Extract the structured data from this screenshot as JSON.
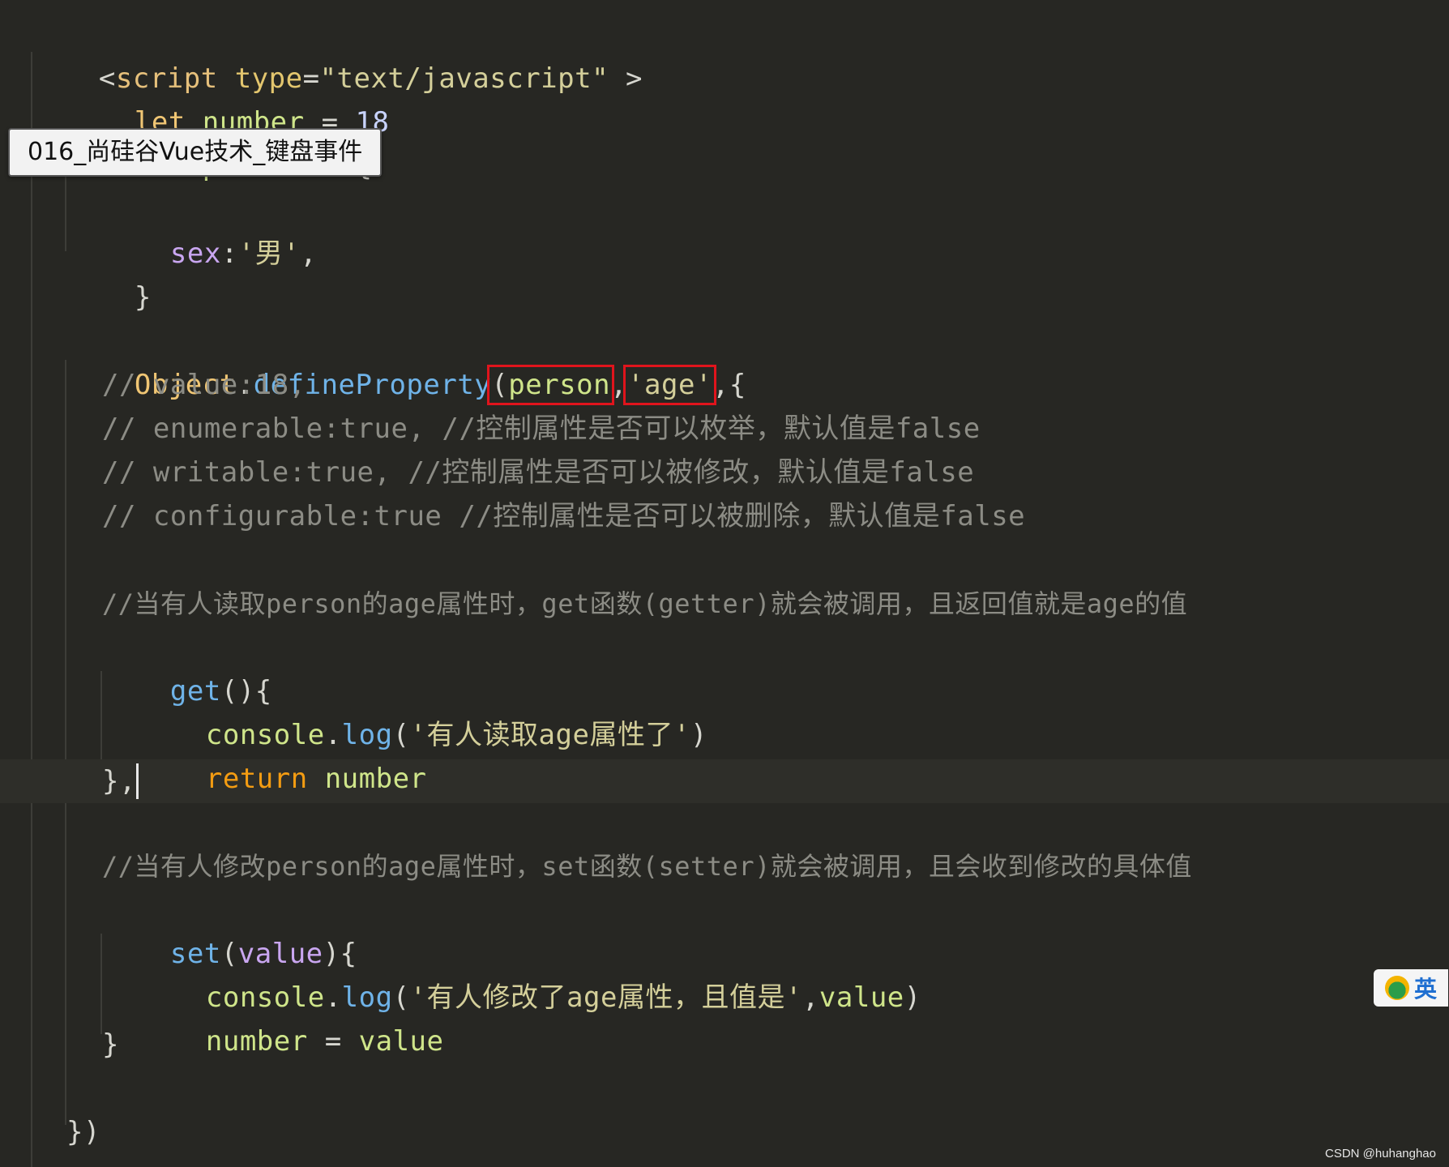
{
  "tooltip": {
    "text": "016_尚硅谷Vue技术_键盘事件"
  },
  "code": {
    "l1": {
      "open": "<",
      "tag": "script",
      "sp": " ",
      "attr": "type",
      "eq": "=",
      "val": "\"text/javascript\"",
      "close": " >"
    },
    "l2": {
      "kw": "let",
      "name": "number",
      "eq": " = ",
      "num": "18"
    },
    "l3": {
      "kw": "let",
      "name": "person",
      "eq": " = ",
      "brace": "{"
    },
    "l4": {
      "prop": "sex",
      "colon": ":",
      "str": "'男'",
      "comma": ","
    },
    "l5": {
      "brace": "}"
    },
    "l6": {
      "obj": "Object",
      "dot": ".",
      "fn": "defineProperty",
      "paren": "(",
      "arg1": "person",
      "comma1": ",",
      "arg2": "'age'",
      "comma2": ",",
      "brace": "{"
    },
    "l7": {
      "cmt": "// value:18,"
    },
    "l8": {
      "cmt": "// enumerable:true, //控制属性是否可以枚举，默认值是false"
    },
    "l9": {
      "cmt": "// writable:true, //控制属性是否可以被修改，默认值是false"
    },
    "l10": {
      "cmt": "// configurable:true //控制属性是否可以被删除，默认值是false"
    },
    "l11": {
      "cmt": "//当有人读取person的age属性时，get函数(getter)就会被调用，且返回值就是age的值"
    },
    "l12": {
      "fn": "get",
      "rest": "(){"
    },
    "l13": {
      "obj": "console",
      "dot": ".",
      "fn": "log",
      "open": "(",
      "str": "'有人读取age属性了'",
      "close": ")"
    },
    "l14": {
      "kw": "return",
      "var": "number"
    },
    "l15": {
      "text": "},"
    },
    "l16": {
      "cmt": "//当有人修改person的age属性时，set函数(setter)就会被调用，且会收到修改的具体值"
    },
    "l17": {
      "fn": "set",
      "open": "(",
      "param": "value",
      "close": "){"
    },
    "l18": {
      "obj": "console",
      "dot": ".",
      "fn": "log",
      "open": "(",
      "str": "'有人修改了age属性，且值是'",
      "comma": ",",
      "arg": "value",
      "close": ")"
    },
    "l19": {
      "var": "number",
      "eq": " = ",
      "val": "value"
    },
    "l20": {
      "text": "}"
    },
    "l21": {
      "text": "})"
    }
  },
  "ime": {
    "label": "英"
  },
  "watermark": "CSDN @huhanghao",
  "colors": {
    "background": "#272723",
    "highlight_box": "#e0141c",
    "keyword": "#f0c674",
    "function": "#6fb3e8",
    "comment": "#8c8c85"
  }
}
